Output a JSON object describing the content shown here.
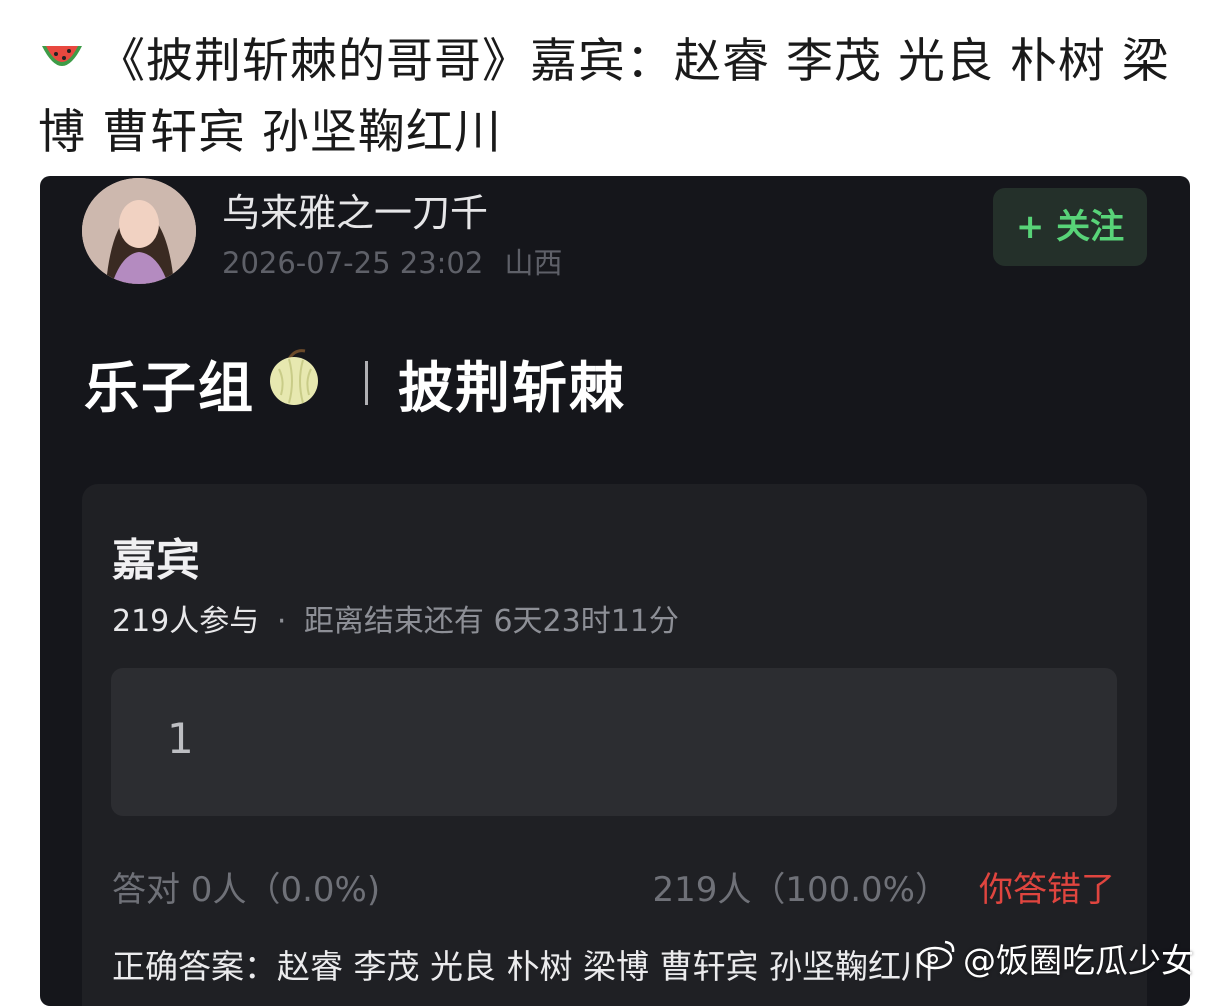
{
  "post": {
    "headline": "《披荆斩棘的哥哥》嘉宾：赵睿 李茂 光良 朴树 梁博 曹轩宾 孙坚鞠红川",
    "headline_icon": "watermelon-icon"
  },
  "card": {
    "username": "乌来雅之一刀千",
    "timestamp": "2026-07-25 23:02",
    "location": "山西",
    "follow_label": "+ 关注",
    "title_left": "乐子组",
    "title_icon": "melon-icon",
    "title_right": "披荆斩棘"
  },
  "quiz": {
    "title": "嘉宾",
    "participants": "219人参与",
    "separator": "·",
    "countdown": "距离结束还有 6天23时11分",
    "option": "1",
    "correct_stats": "答对  0人（0.0%)",
    "wrong_stats": "219人（100.0%）",
    "result": "你答错了",
    "answer": "正确答案：赵睿 李茂 光良 朴树 梁博 曹轩宾 孙坚鞠红川"
  },
  "watermark": {
    "text": "@饭圈吃瓜少女",
    "icon": "weibo-icon"
  },
  "colors": {
    "card_bg": "#15161b",
    "quiz_bg": "#1f2024",
    "follow_green": "#58d378",
    "wrong_red": "#e0453f"
  }
}
